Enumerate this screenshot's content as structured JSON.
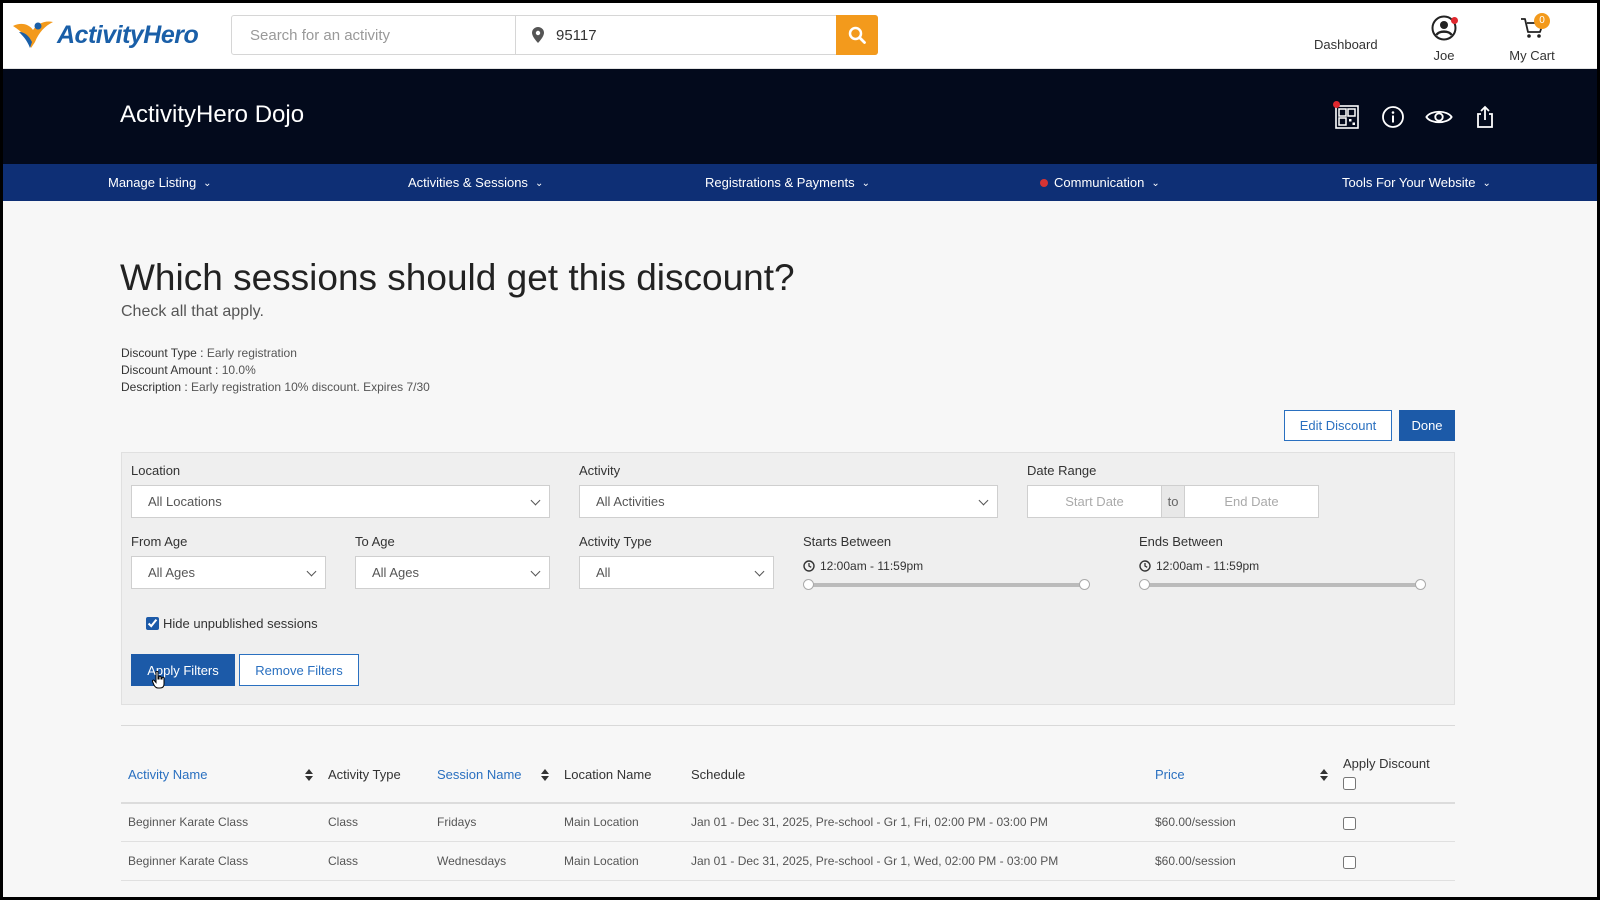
{
  "brand": {
    "name": "ActivityHero",
    "primary": "#1a5fa8",
    "accent": "#f39a1c",
    "header_bg": "#030a1c",
    "nav_bg": "#0e2f75"
  },
  "search": {
    "activity_placeholder": "Search for an activity",
    "location_value": "95117",
    "icon": "search-icon"
  },
  "usernav": {
    "dashboard": "Dashboard",
    "user": "Joe",
    "cart": "My Cart",
    "cart_count": "0"
  },
  "header": {
    "title": "ActivityHero Dojo",
    "icons": [
      "qr-code-icon",
      "info-icon",
      "eye-icon",
      "share-icon"
    ]
  },
  "nav": {
    "items": [
      {
        "label": "Manage Listing"
      },
      {
        "label": "Activities & Sessions"
      },
      {
        "label": "Registrations & Payments"
      },
      {
        "label": "Communication"
      },
      {
        "label": "Tools For Your Website"
      }
    ]
  },
  "page": {
    "title": "Which sessions should get this discount?",
    "subtitle": "Check all that apply.",
    "discount_type_label": "Discount Type",
    "discount_type": "Early registration",
    "discount_amount_label": "Discount Amount",
    "discount_amount": "10.0%",
    "description_label": "Description",
    "description": "Early registration 10% discount. Expires 7/30",
    "edit_button": "Edit Discount",
    "done_button": "Done"
  },
  "filters": {
    "location_label": "Location",
    "location_value": "All Locations",
    "activity_label": "Activity",
    "activity_value": "All Activities",
    "date_range_label": "Date Range",
    "start_placeholder": "Start Date",
    "to": "to",
    "end_placeholder": "End Date",
    "from_age_label": "From Age",
    "from_age_value": "All Ages",
    "to_age_label": "To Age",
    "to_age_value": "All Ages",
    "activity_type_label": "Activity Type",
    "activity_type_value": "All",
    "starts_between_label": "Starts Between",
    "starts_between_value": "12:00am - 11:59pm",
    "ends_between_label": "Ends Between",
    "ends_between_value": "12:00am - 11:59pm",
    "hide_unpublished_label": "Hide unpublished sessions",
    "apply_button": "Apply Filters",
    "remove_button": "Remove Filters"
  },
  "table": {
    "headers": {
      "activity_name": "Activity Name",
      "activity_type": "Activity Type",
      "session_name": "Session Name",
      "location_name": "Location Name",
      "schedule": "Schedule",
      "price": "Price",
      "apply_discount": "Apply Discount"
    },
    "rows": [
      {
        "activity_name": "Beginner Karate Class",
        "activity_type": "Class",
        "session_name": "Fridays",
        "location_name": "Main Location",
        "schedule": "Jan 01 - Dec 31, 2025, Pre-school - Gr 1, Fri, 02:00 PM - 03:00 PM",
        "price": "$60.00/session"
      },
      {
        "activity_name": "Beginner Karate Class",
        "activity_type": "Class",
        "session_name": "Wednesdays",
        "location_name": "Main Location",
        "schedule": "Jan 01 - Dec 31, 2025, Pre-school - Gr 1, Wed, 02:00 PM - 03:00 PM",
        "price": "$60.00/session"
      }
    ]
  }
}
